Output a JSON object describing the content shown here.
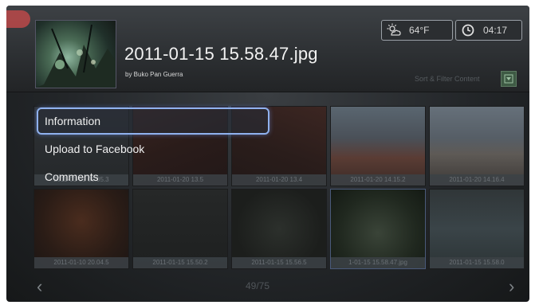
{
  "header": {
    "title": "2011-01-15 15.58.47.jpg",
    "subtitle": "by Buko Pan Guerra",
    "weather": "64°F",
    "time": "04:17",
    "sort_label": "Sort & Filter Content"
  },
  "menu": {
    "items": [
      {
        "label": "Information"
      },
      {
        "label": "Upload to Facebook"
      },
      {
        "label": "Comments"
      }
    ],
    "selected_index": 0
  },
  "grid": {
    "row1": [
      {
        "caption": "2011-01-09 09.05.3"
      },
      {
        "caption": "2011-01-20 13.5"
      },
      {
        "caption": "2011-01-20 13.4"
      },
      {
        "caption": "2011-01-20 14.15.2"
      },
      {
        "caption": "2011-01-20 14.16.4"
      }
    ],
    "row2": [
      {
        "caption": "2011-01-10 20.04.5"
      },
      {
        "caption": "2011-01-15 15.50.2"
      },
      {
        "caption": "2011-01-15 15.56.5"
      },
      {
        "caption": "1-01-15 15.58.47.jpg"
      },
      {
        "caption": "2011-01-15 15.58.0"
      }
    ]
  },
  "footer": {
    "page": "49/75",
    "prev": "‹",
    "next": "›"
  },
  "colors": {
    "accent": "#8fb1ee",
    "background": "#232629"
  },
  "icons": [
    "weather-icon",
    "clock-icon",
    "sort-filter-icon",
    "prev-arrow-icon",
    "next-arrow-icon"
  ]
}
